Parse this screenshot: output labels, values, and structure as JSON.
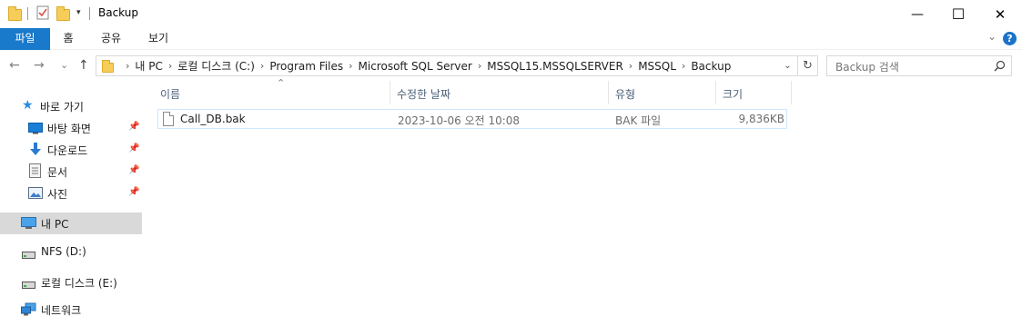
{
  "window": {
    "title": "Backup",
    "minimize_glyph": "—",
    "maximize_glyph": "☐",
    "close_glyph": "✕"
  },
  "ribbon": {
    "tabs": [
      "파일",
      "홈",
      "공유",
      "보기"
    ],
    "help_label": "?",
    "collapse_glyph": "⌄"
  },
  "nav": {
    "back_glyph": "←",
    "forward_glyph": "→",
    "recent_glyph": "⌄",
    "up_glyph": "↑"
  },
  "address": {
    "crumbs": [
      "내 PC",
      "로컬 디스크 (C:)",
      "Program Files",
      "Microsoft SQL Server",
      "MSSQL15.MSSQLSERVER",
      "MSSQL",
      "Backup"
    ],
    "separator": "›",
    "dropdown_glyph": "⌄",
    "refresh_glyph": "↻"
  },
  "search": {
    "placeholder": "Backup 검색",
    "icon": "search-icon"
  },
  "navpane": {
    "quick_access": "바로 가기",
    "pinned": [
      {
        "label": "바탕 화면",
        "icon": "desktop-icon"
      },
      {
        "label": "다운로드",
        "icon": "download-icon"
      },
      {
        "label": "문서",
        "icon": "documents-icon"
      },
      {
        "label": "사진",
        "icon": "pictures-icon"
      }
    ],
    "this_pc": "내 PC",
    "drives": [
      "NFS (D:)",
      "로컬 디스크 (E:)"
    ],
    "network": "네트워크"
  },
  "columns": {
    "name": "이름",
    "date": "수정한 날짜",
    "type": "유형",
    "size": "크기"
  },
  "files": [
    {
      "name": "Call_DB.bak",
      "date": "2023-10-06 오전 10:08",
      "type": "BAK 파일",
      "size": "9,836KB"
    }
  ],
  "colors": {
    "accent": "#1979ca",
    "selection_border": "#cde8ff",
    "selected_nav": "#d9d9d9"
  }
}
